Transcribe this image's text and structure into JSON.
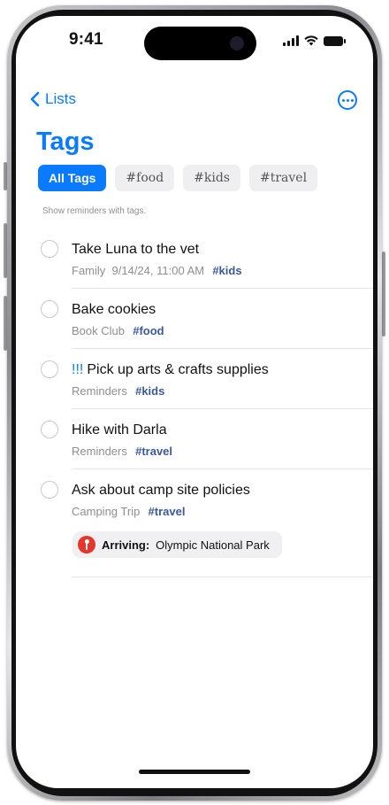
{
  "status_bar": {
    "time": "9:41"
  },
  "nav": {
    "back_label": "Lists"
  },
  "page": {
    "title": "Tags",
    "hint": "Show reminders with tags."
  },
  "chips": [
    {
      "label": "All Tags",
      "active": true
    },
    {
      "label": "#food",
      "active": false
    },
    {
      "label": "#kids",
      "active": false
    },
    {
      "label": "#travel",
      "active": false
    }
  ],
  "reminders": [
    {
      "title": "Take Luna to the vet",
      "priority": "",
      "list": "Family",
      "date": "9/14/24, 11:00 AM",
      "tag": "#kids"
    },
    {
      "title": "Bake cookies",
      "priority": "",
      "list": "Book Club",
      "date": "",
      "tag": "#food"
    },
    {
      "title": "Pick up arts & crafts supplies",
      "priority": "!!!",
      "list": "Reminders",
      "date": "",
      "tag": "#kids"
    },
    {
      "title": "Hike with Darla",
      "priority": "",
      "list": "Reminders",
      "date": "",
      "tag": "#travel"
    },
    {
      "title": "Ask about camp site policies",
      "priority": "",
      "list": "Camping Trip",
      "date": "",
      "tag": "#travel",
      "location": {
        "label": "Arriving:",
        "place": "Olympic National Park"
      }
    }
  ],
  "colors": {
    "accent": "#0a7aff",
    "tag": "#3a5a99",
    "location_pin": "#e5362b"
  }
}
